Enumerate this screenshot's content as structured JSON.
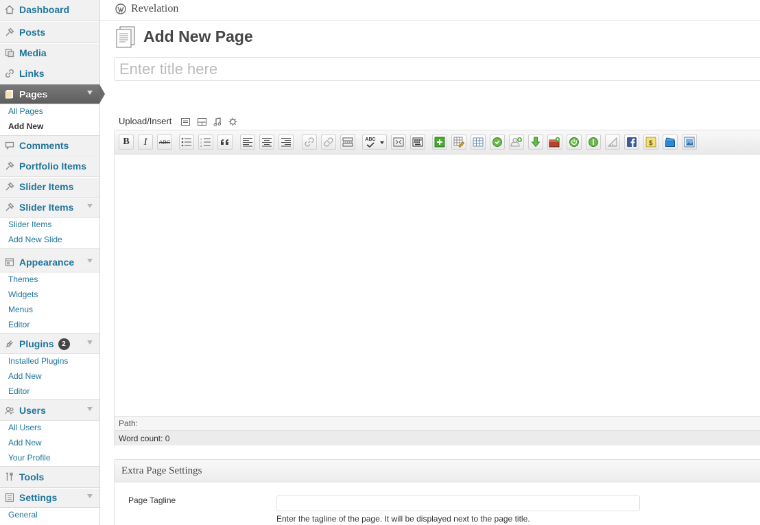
{
  "colors": {
    "link": "#21759b",
    "current_menu": "#6a6a6a",
    "sidebar_bg": "#f1f1f1"
  },
  "sidebar": {
    "dashboard": "Dashboard",
    "posts": "Posts",
    "media": "Media",
    "links": "Links",
    "pages": "Pages",
    "pages_sub": [
      "All Pages",
      "Add New"
    ],
    "comments": "Comments",
    "portfolio": "Portfolio Items",
    "slider1": "Slider Items",
    "slider2": "Slider Items",
    "slider_sub": [
      "Slider Items",
      "Add New Slide"
    ],
    "appearance": "Appearance",
    "appearance_sub": [
      "Themes",
      "Widgets",
      "Menus",
      "Editor"
    ],
    "plugins": "Plugins",
    "plugins_badge": "2",
    "plugins_sub": [
      "Installed Plugins",
      "Add New",
      "Editor"
    ],
    "users": "Users",
    "users_sub": [
      "All Users",
      "Add New",
      "Your Profile"
    ],
    "tools": "Tools",
    "settings": "Settings",
    "settings_sub": [
      "General"
    ]
  },
  "header": {
    "site_name": "Revelation",
    "site_icon": "wordpress-logo-icon"
  },
  "main": {
    "page_title": "Add New Page",
    "page_icon": "page-icon",
    "title_placeholder": "Enter title here",
    "upload_label": "Upload/Insert",
    "media_buttons": [
      "add-image-icon",
      "add-video-icon",
      "add-audio-icon",
      "add-media-icon"
    ],
    "path_label": "Path:",
    "word_count": "Word count: 0"
  },
  "toolbar": {
    "bold": "B",
    "italic": "I",
    "strike": "ABC",
    "spell": "ABC",
    "buttons": [
      "bold",
      "italic",
      "strikethrough",
      "bullet-list",
      "numbered-list",
      "blockquote",
      "align-left",
      "align-center",
      "align-right",
      "link",
      "unlink",
      "more-tag",
      "spellcheck",
      "fullscreen",
      "kitchen-sink",
      "add-shortcode",
      "edit-table",
      "table",
      "green-check",
      "add-user",
      "download",
      "gift-box",
      "power-toggle",
      "power-toggle-2",
      "ruler",
      "facebook",
      "dollar",
      "clapperboard",
      "image-frame"
    ]
  },
  "meta_box": {
    "title": "Extra Page Settings",
    "tagline_label": "Page Tagline",
    "tagline_value": "",
    "tagline_help": "Enter the tagline of the page. It will be displayed next to the page title."
  }
}
